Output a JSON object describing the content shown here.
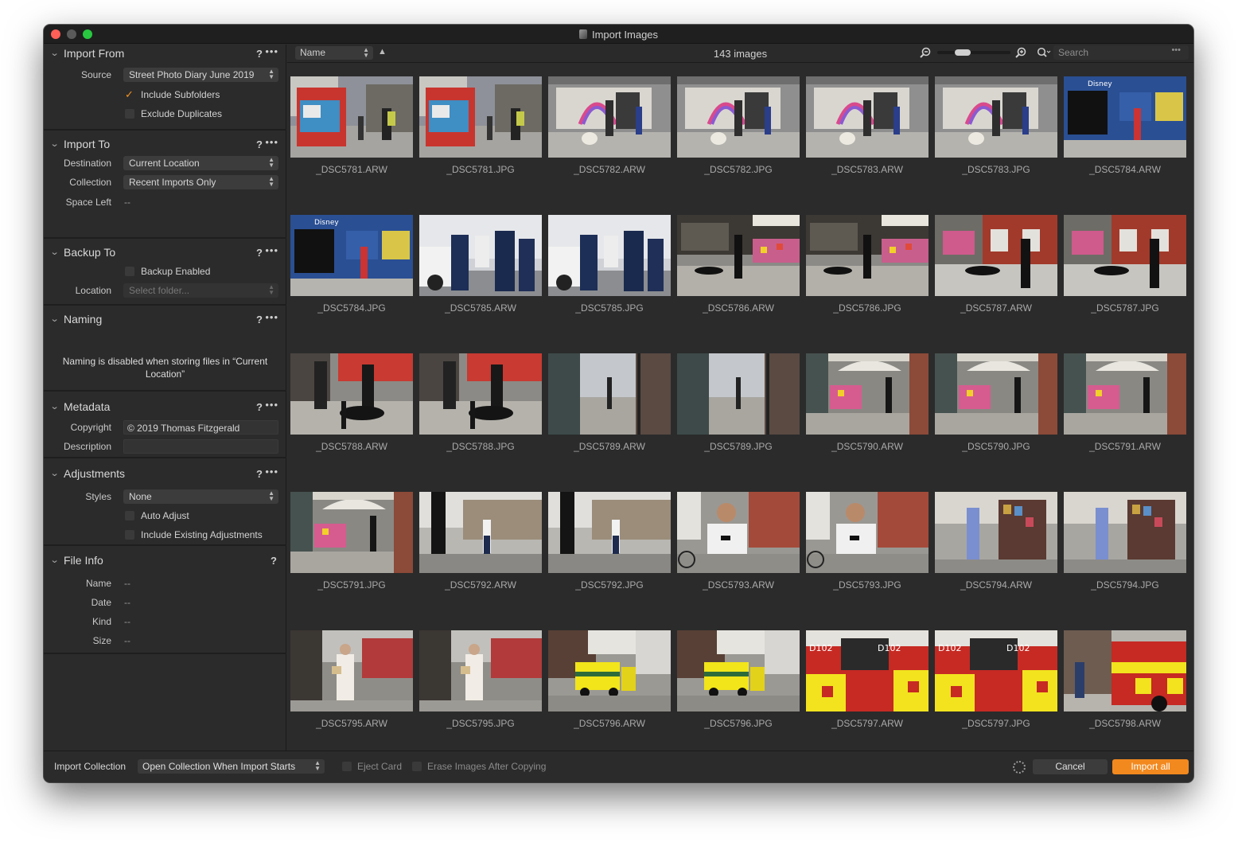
{
  "window": {
    "title": "Import Images"
  },
  "sidebar": {
    "import_from": {
      "title": "Import From",
      "help": "?",
      "more": "•••",
      "source_label": "Source",
      "source_value": "Street Photo Diary June 2019",
      "include_subfolders": "Include Subfolders",
      "exclude_duplicates": "Exclude Duplicates",
      "checkmark": "✓"
    },
    "import_to": {
      "title": "Import To",
      "help": "?",
      "more": "•••",
      "destination_label": "Destination",
      "destination_value": "Current Location",
      "collection_label": "Collection",
      "collection_value": "Recent Imports Only",
      "space_left_label": "Space Left",
      "space_left_value": "--"
    },
    "backup_to": {
      "title": "Backup To",
      "help": "?",
      "more": "•••",
      "backup_enabled": "Backup Enabled",
      "location_label": "Location",
      "location_placeholder": "Select folder..."
    },
    "naming": {
      "title": "Naming",
      "help": "?",
      "more": "•••",
      "note": "Naming is disabled when storing files in “Current Location”"
    },
    "metadata": {
      "title": "Metadata",
      "help": "?",
      "more": "•••",
      "copyright_label": "Copyright",
      "copyright_value": "© 2019 Thomas Fitzgerald",
      "description_label": "Description",
      "description_value": ""
    },
    "adjustments": {
      "title": "Adjustments",
      "help": "?",
      "more": "•••",
      "styles_label": "Styles",
      "styles_value": "None",
      "auto_adjust": "Auto Adjust",
      "include_existing": "Include Existing Adjustments"
    },
    "file_info": {
      "title": "File Info",
      "help": "?",
      "name_label": "Name",
      "name_value": "--",
      "date_label": "Date",
      "date_value": "--",
      "kind_label": "Kind",
      "kind_value": "--",
      "size_label": "Size",
      "size_value": "--"
    }
  },
  "toolbar": {
    "sort_value": "Name",
    "sort_direction": "▲",
    "image_count": "143 images",
    "search_placeholder": "Search",
    "search_more": "•••",
    "zoom_level": 0.3
  },
  "thumbnails": [
    {
      "name": "_DSC5781.ARW",
      "scene": "kiosk"
    },
    {
      "name": "_DSC5781.JPG",
      "scene": "kiosk"
    },
    {
      "name": "_DSC5782.ARW",
      "scene": "rainbow"
    },
    {
      "name": "_DSC5782.JPG",
      "scene": "rainbow"
    },
    {
      "name": "_DSC5783.ARW",
      "scene": "rainbow"
    },
    {
      "name": "_DSC5783.JPG",
      "scene": "rainbow"
    },
    {
      "name": "_DSC5784.ARW",
      "scene": "bluestore"
    },
    {
      "name": "_DSC5784.JPG",
      "scene": "bluestore"
    },
    {
      "name": "_DSC5785.ARW",
      "scene": "police"
    },
    {
      "name": "_DSC5785.JPG",
      "scene": "police"
    },
    {
      "name": "_DSC5786.ARW",
      "scene": "flowershop"
    },
    {
      "name": "_DSC5786.JPG",
      "scene": "flowershop"
    },
    {
      "name": "_DSC5787.ARW",
      "scene": "redbrick"
    },
    {
      "name": "_DSC5787.JPG",
      "scene": "redbrick"
    },
    {
      "name": "_DSC5788.ARW",
      "scene": "dog"
    },
    {
      "name": "_DSC5788.JPG",
      "scene": "dog"
    },
    {
      "name": "_DSC5789.ARW",
      "scene": "street"
    },
    {
      "name": "_DSC5789.JPG",
      "scene": "street"
    },
    {
      "name": "_DSC5790.ARW",
      "scene": "umbrella"
    },
    {
      "name": "_DSC5790.JPG",
      "scene": "umbrella"
    },
    {
      "name": "_DSC5791.ARW",
      "scene": "umbrella"
    },
    {
      "name": "_DSC5791.JPG",
      "scene": "umbrella"
    },
    {
      "name": "_DSC5792.ARW",
      "scene": "pedestrian"
    },
    {
      "name": "_DSC5792.JPG",
      "scene": "pedestrian"
    },
    {
      "name": "_DSC5793.ARW",
      "scene": "man"
    },
    {
      "name": "_DSC5793.JPG",
      "scene": "man"
    },
    {
      "name": "_DSC5794.ARW",
      "scene": "postcards"
    },
    {
      "name": "_DSC5794.JPG",
      "scene": "postcards"
    },
    {
      "name": "_DSC5795.ARW",
      "scene": "woman"
    },
    {
      "name": "_DSC5795.JPG",
      "scene": "woman"
    },
    {
      "name": "_DSC5796.ARW",
      "scene": "ambulance"
    },
    {
      "name": "_DSC5796.JPG",
      "scene": "ambulance"
    },
    {
      "name": "_DSC5797.ARW",
      "scene": "firetruck"
    },
    {
      "name": "_DSC5797.JPG",
      "scene": "firetruck"
    },
    {
      "name": "_DSC5798.ARW",
      "scene": "firetruck2"
    }
  ],
  "bottom": {
    "import_collection_label": "Import Collection",
    "import_collection_value": "Open Collection When Import Starts",
    "eject_card": "Eject Card",
    "erase_images": "Erase Images After Copying",
    "cancel": "Cancel",
    "import_all": "Import all"
  },
  "colors": {
    "accent": "#f2891f",
    "background": "#2b2b2b"
  }
}
